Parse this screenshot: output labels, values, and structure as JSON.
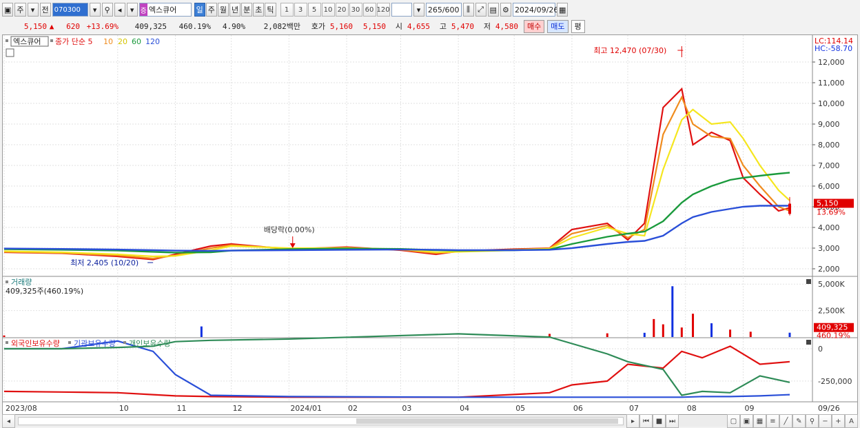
{
  "toolbar": {
    "market_label": "주",
    "prev_label": "전",
    "stock_code": "070300",
    "stock_tag": "증",
    "stock_name": "엑스큐어",
    "periods": [
      "일",
      "주",
      "월",
      "년",
      "분",
      "초",
      "틱"
    ],
    "selected_period": "일",
    "intervals": [
      "1",
      "3",
      "5",
      "10",
      "20",
      "30",
      "60",
      "120"
    ],
    "count_value": "265",
    "count_max": "/600",
    "date_value": "2024/09/26"
  },
  "quote": {
    "price": "5,150",
    "change": "620",
    "change_pct": "+13.69%",
    "volume": "409,325",
    "volume_ratio": "460.19%",
    "turnover_rate": "4.90%",
    "amount": "2,082백만",
    "bid_label": "호가",
    "bid_ask": "5,160",
    "bid": "5,150",
    "open_label": "시",
    "open": "4,655",
    "high_label": "고",
    "high": "5,470",
    "low_label": "저",
    "low": "4,580",
    "buy_label": "매수",
    "sell_label": "매도",
    "eval_label": "평"
  },
  "colors": {
    "up": "#e00000",
    "down": "#1030e0",
    "ma5": "#e01010",
    "ma10": "#f08c1e",
    "ma20": "#f5e61e",
    "ma60": "#1a9a3c",
    "ma120": "#2a4fd8",
    "foreign": "#e01010",
    "institution": "#2a4fd8",
    "individual": "#2e8b57"
  },
  "chart_data": [
    {
      "type": "line",
      "title": "엑스큐어",
      "legend": [
        "종가 단순 5",
        "10",
        "20",
        "60",
        "120"
      ],
      "y_ticks": [
        "12,000",
        "11,000",
        "10,000",
        "9,000",
        "8,000",
        "7,000",
        "6,000",
        "5,000",
        "4,000",
        "3,000",
        "2,000"
      ],
      "ylim": [
        1800,
        12700
      ],
      "x_ticks": [
        "2023/08",
        "10",
        "11",
        "12",
        "2024/01",
        "02",
        "03",
        "04",
        "05",
        "06",
        "07",
        "08",
        "09",
        "09/26"
      ],
      "x": [
        "2023-08-01",
        "2023-09-01",
        "2023-10-01",
        "2023-10-20",
        "2023-11-01",
        "2023-11-20",
        "2023-12-01",
        "2024-01-01",
        "2024-02-01",
        "2024-03-01",
        "2024-03-20",
        "2024-04-01",
        "2024-05-01",
        "2024-05-20",
        "2024-06-01",
        "2024-06-20",
        "2024-07-01",
        "2024-07-10",
        "2024-07-20",
        "2024-07-30",
        "2024-08-05",
        "2024-08-15",
        "2024-08-25",
        "2024-09-01",
        "2024-09-10",
        "2024-09-20",
        "2024-09-26"
      ],
      "series": [
        {
          "name": "종가 단순 5",
          "values": [
            2800,
            2750,
            2600,
            2450,
            2700,
            3100,
            3200,
            2950,
            3050,
            2900,
            2700,
            2850,
            2950,
            3000,
            3900,
            4200,
            3400,
            4200,
            9800,
            10700,
            8000,
            8600,
            8200,
            6400,
            5600,
            4800,
            4950
          ]
        },
        {
          "name": "10",
          "values": [
            2820,
            2760,
            2650,
            2500,
            2650,
            3000,
            3150,
            2980,
            3020,
            2920,
            2750,
            2830,
            2930,
            2990,
            3700,
            4100,
            3500,
            3900,
            8500,
            10300,
            9000,
            8400,
            8300,
            7000,
            6000,
            5000,
            4800
          ]
        },
        {
          "name": "20",
          "values": [
            2850,
            2800,
            2700,
            2600,
            2620,
            2900,
            3100,
            3000,
            3000,
            2950,
            2800,
            2820,
            2900,
            2970,
            3500,
            4000,
            3700,
            3600,
            6800,
            9200,
            9700,
            9000,
            9100,
            8300,
            7000,
            5800,
            5300
          ]
        },
        {
          "name": "60",
          "values": [
            2950,
            2920,
            2880,
            2820,
            2780,
            2800,
            2880,
            2950,
            2980,
            2960,
            2900,
            2880,
            2900,
            2930,
            3200,
            3550,
            3700,
            3800,
            4300,
            5200,
            5600,
            6000,
            6300,
            6400,
            6500,
            6600,
            6650
          ]
        },
        {
          "name": "120",
          "values": [
            2980,
            2960,
            2930,
            2900,
            2880,
            2870,
            2880,
            2900,
            2920,
            2930,
            2920,
            2900,
            2900,
            2920,
            3000,
            3200,
            3300,
            3350,
            3600,
            4200,
            4500,
            4750,
            4900,
            5000,
            5050,
            5050,
            5050
          ]
        }
      ],
      "annotations": [
        {
          "text": "최고 12,470 (07/30)",
          "x": "2024-07-30",
          "y": 12470
        },
        {
          "text": "최저 2,405 (10/20)",
          "x": "2023-10-20",
          "y": 2405
        },
        {
          "text": "배당락(0.00%)",
          "x": "2024-01-03",
          "y": 3100
        }
      ],
      "right_labels": {
        "lc": "LC:114.14",
        "hc": "HC:-58.70",
        "last_price": "5,150",
        "last_pct": "13.69%"
      },
      "last_close": 5150
    },
    {
      "type": "bar",
      "title": "거래량",
      "subtitle": "409,325주(460.19%)",
      "y_ticks": [
        "5,000K",
        "2,500K"
      ],
      "ylim": [
        0,
        5600000
      ],
      "x": [
        "2023-08-01",
        "2023-11-15",
        "2024-05-20",
        "2024-06-20",
        "2024-07-10",
        "2024-07-15",
        "2024-07-20",
        "2024-07-25",
        "2024-07-30",
        "2024-08-05",
        "2024-08-15",
        "2024-08-25",
        "2024-09-05",
        "2024-09-26"
      ],
      "values": [
        150000,
        1000000,
        300000,
        350000,
        400000,
        1700000,
        1200000,
        4800000,
        900000,
        2200000,
        1300000,
        700000,
        500000,
        409325
      ],
      "right_labels": {
        "volume": "409,325",
        "ratio": "460.19%"
      }
    },
    {
      "type": "line",
      "legend": [
        "외국인보유수량",
        "기관보유수량",
        "개인보유수량"
      ],
      "y_ticks": [
        "0",
        "-250,000"
      ],
      "ylim": [
        -400000,
        80000
      ],
      "x": [
        "2023-08-01",
        "2023-09-01",
        "2023-10-01",
        "2023-10-20",
        "2023-11-01",
        "2023-11-20",
        "2024-01-01",
        "2024-04-01",
        "2024-05-20",
        "2024-06-01",
        "2024-06-20",
        "2024-07-01",
        "2024-07-20",
        "2024-07-30",
        "2024-08-10",
        "2024-08-25",
        "2024-09-10",
        "2024-09-26"
      ],
      "series": [
        {
          "name": "외국인보유수량",
          "values": [
            -330000,
            -335000,
            -340000,
            -355000,
            -365000,
            -370000,
            -375000,
            -375000,
            -340000,
            -280000,
            -250000,
            -120000,
            -150000,
            -20000,
            -70000,
            20000,
            -120000,
            -100000
          ]
        },
        {
          "name": "기관보유수량",
          "values": [
            0,
            0,
            60000,
            -20000,
            -200000,
            -360000,
            -370000,
            -375000,
            -375000,
            -375000,
            -375000,
            -375000,
            -375000,
            -375000,
            -370000,
            -370000,
            -365000,
            -355000
          ]
        },
        {
          "name": "개인보유수량",
          "values": [
            0,
            0,
            10000,
            20000,
            55000,
            65000,
            75000,
            115000,
            90000,
            40000,
            -40000,
            -100000,
            -160000,
            -360000,
            -330000,
            -340000,
            -210000,
            -260000
          ]
        }
      ]
    }
  ],
  "x_axis": {
    "labels": [
      "2023/08",
      "10",
      "11",
      "12",
      "2024/01",
      "02",
      "03",
      "04",
      "05",
      "06",
      "07",
      "08",
      "09",
      "09/26"
    ]
  }
}
